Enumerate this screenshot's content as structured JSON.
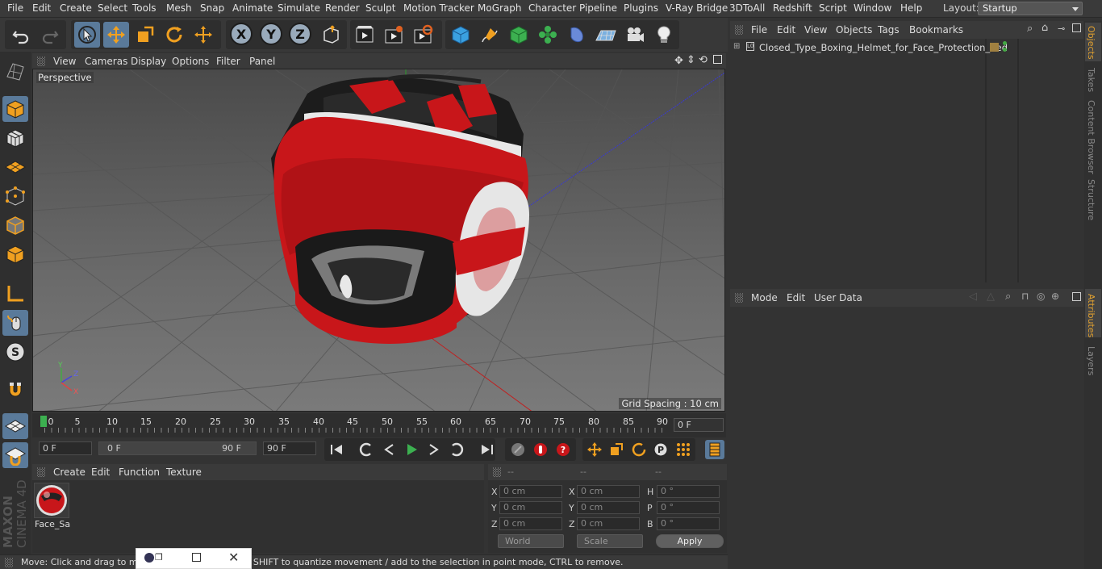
{
  "menubar": {
    "items": [
      "File",
      "Edit",
      "Create",
      "Select",
      "Tools",
      "Mesh",
      "Snap",
      "Animate",
      "Simulate",
      "Render",
      "Sculpt",
      "Motion Tracker",
      "MoGraph",
      "Character",
      "Pipeline",
      "Plugins",
      "V-Ray Bridge",
      "3DToAll",
      "Redshift",
      "Script",
      "Window",
      "Help"
    ],
    "layout_label": "Layout:",
    "layout_value": "Startup"
  },
  "toolbar": {
    "icons": [
      "undo-icon",
      "redo-icon",
      "live-selection-icon",
      "move-icon",
      "scale-icon",
      "rotate-icon",
      "recent-tool-icon",
      "x-axis-lock",
      "y-axis-lock",
      "z-axis-lock",
      "coordinate-system-icon",
      "render-view-icon",
      "render-picture-viewer-icon",
      "render-settings-icon",
      "cube-primitive-icon",
      "pen-spline-icon",
      "subdivision-icon",
      "cloner-icon",
      "deformer-icon",
      "floor-icon",
      "camera-icon",
      "light-icon"
    ],
    "x": "X",
    "y": "Y",
    "z": "Z"
  },
  "lefttools": {
    "icons": [
      "make-editable-icon",
      "model-mode-icon",
      "texture-mode-icon",
      "workplane-icon",
      "points-mode-icon",
      "edges-mode-icon",
      "polygons-mode-icon",
      "axis-mode-icon",
      "tweak-mode-icon",
      "solo-icon",
      "magnet-icon",
      "snap-icon",
      "snap-settings-icon"
    ]
  },
  "brand": {
    "line1": "MAXON",
    "line2": "CINEMA 4D"
  },
  "viewport": {
    "menus": [
      "View",
      "Cameras",
      "Display",
      "Options",
      "Filter",
      "Panel"
    ],
    "label": "Perspective",
    "grid_spacing": "Grid Spacing : 10 cm",
    "axis": {
      "y": "Y",
      "z": "Z",
      "x": "X"
    }
  },
  "timeline": {
    "ticks": [
      "0",
      "5",
      "10",
      "15",
      "20",
      "25",
      "30",
      "35",
      "40",
      "45",
      "50",
      "55",
      "60",
      "65",
      "70",
      "75",
      "80",
      "85",
      "90"
    ],
    "current_frame": "0 F"
  },
  "transport": {
    "start": "0 F",
    "range_start": "0 F",
    "range_end": "90 F",
    "end": "90 F"
  },
  "material_manager": {
    "menus": [
      "Create",
      "Edit",
      "Function",
      "Texture"
    ],
    "material_name": "Face_Sa"
  },
  "coordinates": {
    "headers": [
      "--",
      "--",
      "--"
    ],
    "rows": [
      {
        "a_label": "X",
        "a_val": "0 cm",
        "b_label": "X",
        "b_val": "0 cm",
        "c_label": "H",
        "c_val": "0 °"
      },
      {
        "a_label": "Y",
        "a_val": "0 cm",
        "b_label": "Y",
        "b_val": "0 cm",
        "c_label": "P",
        "c_val": "0 °"
      },
      {
        "a_label": "Z",
        "a_val": "0 cm",
        "b_label": "Z",
        "b_val": "0 cm",
        "c_label": "B",
        "c_val": "0 °"
      }
    ],
    "mode": "World",
    "transform": "Scale",
    "apply": "Apply"
  },
  "objects_panel": {
    "menus": [
      "File",
      "Edit",
      "View",
      "Objects",
      "Tags",
      "Bookmarks"
    ],
    "object_name": "Closed_Type_Boxing_Helmet_for_Face_Protection_Red"
  },
  "attributes_panel": {
    "menus": [
      "Mode",
      "Edit",
      "User Data"
    ]
  },
  "right_tabs": [
    "Objects",
    "Takes",
    "Content Browser",
    "Structure",
    "Attributes",
    "Layers"
  ],
  "status": {
    "text": "Move: Click and drag to move elements. Hold down SHIFT to quantize movement / add to the selection in point mode, CTRL to remove."
  },
  "colors": {
    "accent": "#5a7a9a",
    "helmet_red": "#c8161a",
    "active_tab": "#e0a030"
  }
}
